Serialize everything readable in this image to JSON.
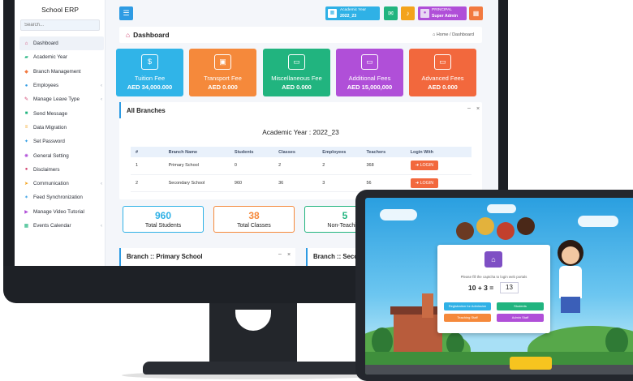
{
  "sidebar": {
    "brand": "School ERP",
    "search_placeholder": "Search...",
    "items": [
      {
        "label": "Dashboard",
        "icon": "home-icon",
        "glyph": "⌂",
        "color": "#d03b6a",
        "chev": ""
      },
      {
        "label": "Academic Year",
        "icon": "graduation-cap-icon",
        "glyph": "▰",
        "color": "#21b47f",
        "chev": ""
      },
      {
        "label": "Branch Management",
        "icon": "branch-icon",
        "glyph": "◆",
        "color": "#f2793f",
        "chev": ""
      },
      {
        "label": "Employees",
        "icon": "user-icon",
        "glyph": "●",
        "color": "#2e9be3",
        "chev": "‹"
      },
      {
        "label": "Manage Leave Type",
        "icon": "edit-icon",
        "glyph": "✎",
        "color": "#d03b6a",
        "chev": "‹"
      },
      {
        "label": "Send Message",
        "icon": "message-icon",
        "glyph": "■",
        "color": "#21b47f",
        "chev": ""
      },
      {
        "label": "Data Migration",
        "icon": "migration-icon",
        "glyph": "≡",
        "color": "#f3a31b",
        "chev": ""
      },
      {
        "label": "Set Password",
        "icon": "key-icon",
        "glyph": "✦",
        "color": "#2e9be3",
        "chev": ""
      },
      {
        "label": "General Setting",
        "icon": "gear-icon",
        "glyph": "✺",
        "color": "#b04fd8",
        "chev": ""
      },
      {
        "label": "Disclaimers",
        "icon": "disclaimer-icon",
        "glyph": "●",
        "color": "#d03b6a",
        "chev": ""
      },
      {
        "label": "Communication",
        "icon": "rocket-icon",
        "glyph": "➤",
        "color": "#f3a31b",
        "chev": "‹"
      },
      {
        "label": "Feed Synchronization",
        "icon": "sync-icon",
        "glyph": "✶",
        "color": "#2e9be3",
        "chev": ""
      },
      {
        "label": "Manage Video Tutorial",
        "icon": "video-icon",
        "glyph": "▶",
        "color": "#b04fd8",
        "chev": ""
      },
      {
        "label": "Events Calendar",
        "icon": "calendar-icon",
        "glyph": "▦",
        "color": "#21b47f",
        "chev": "‹"
      }
    ]
  },
  "header": {
    "menu_icon": "☰",
    "academic_year_label": "Academic Year",
    "academic_year_value": "2022_23",
    "mail_icon": "✉",
    "bell_icon": "🔔",
    "user_role": "PRINCIPAL",
    "user_name": "Super Admin",
    "apps_icon": "▦"
  },
  "breadcrumb": {
    "title": "Dashboard",
    "home": "Home",
    "separator": "/",
    "current": "Dashboard"
  },
  "fees": [
    {
      "name": "Tuition Fee",
      "value": "AED 34,000.000",
      "color": "#30b4e8",
      "glyph": "$"
    },
    {
      "name": "Transport Fee",
      "value": "AED 0.000",
      "color": "#f5893b",
      "glyph": "▣"
    },
    {
      "name": "Miscellaneous Fee",
      "value": "AED 0.000",
      "color": "#21b47f",
      "glyph": "▭"
    },
    {
      "name": "Additional Fees",
      "value": "AED 15,000,000",
      "color": "#b04fd8",
      "glyph": "▭"
    },
    {
      "name": "Advanced Fees",
      "value": "AED 0.000",
      "color": "#f2683d",
      "glyph": "▭"
    }
  ],
  "branches_panel": {
    "title": "All Branches",
    "minimize": "–",
    "close": "×",
    "academic_year_line": "Academic Year : 2022_23",
    "columns": [
      "#",
      "Branch Name",
      "Students",
      "Classes",
      "Employees",
      "Teachers",
      "Login With"
    ],
    "rows": [
      [
        "1",
        "Primary School",
        "0",
        "2",
        "2",
        "368"
      ],
      [
        "2",
        "Secondary School",
        "960",
        "36",
        "3",
        "56"
      ]
    ],
    "login_label": "LOGIN"
  },
  "stats": [
    {
      "number": "960",
      "label": "Total Students",
      "color": "#2fb1e6"
    },
    {
      "number": "38",
      "label": "Total Classes",
      "color": "#f5893b"
    },
    {
      "number": "5",
      "label": "Non-Teaching",
      "color": "#21b47f"
    }
  ],
  "lower_panels": {
    "primary": "Branch :: Primary School",
    "secondary": "Branch :: Seco",
    "minimize": "–",
    "close": "×"
  },
  "tablet": {
    "captcha_message": "Please fill the captcha to login web portals",
    "captcha_question": "10 + 3 =",
    "captcha_answer": "13",
    "buttons": [
      {
        "label": "Registration for Admission",
        "color": "#2fb1e6"
      },
      {
        "label": "Students",
        "color": "#21b47f"
      },
      {
        "label": "Teaching Staff",
        "color": "#f5893b"
      },
      {
        "label": "Admin Staff",
        "color": "#b04fd8"
      }
    ]
  }
}
